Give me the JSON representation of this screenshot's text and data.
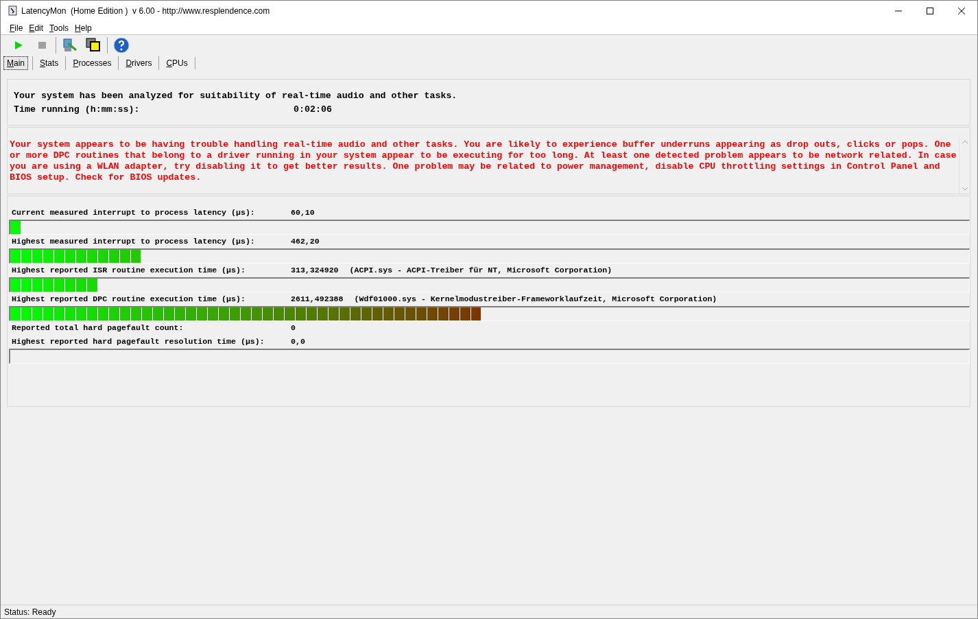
{
  "window": {
    "title": "LatencyMon  (Home Edition )  v 6.00 - http://www.resplendence.com"
  },
  "menu": [
    "File",
    "Edit",
    "Tools",
    "Help"
  ],
  "tabs": [
    {
      "label": "Main",
      "selected": true
    },
    {
      "label": "Stats",
      "selected": false
    },
    {
      "label": "Processes",
      "selected": false
    },
    {
      "label": "Drivers",
      "selected": false
    },
    {
      "label": "CPUs",
      "selected": false
    }
  ],
  "summary": {
    "message": "Your system has been analyzed for suitability of real-time audio and other tasks.",
    "time_label": "Time running (h:mm:ss):",
    "time_value": "0:02:06"
  },
  "verdict": "Your system appears to be having trouble handling real-time audio and other tasks. You are likely to experience buffer underruns appearing as drop outs, clicks or pops. One or more DPC routines that belong to a driver running in your system appear to be executing for too long. At least one detected problem appears to be network related. In case you are using a WLAN adapter, try disabling it to get better results. One problem may be related to power management, disable CPU throttling settings in Control Panel and BIOS setup. Check for BIOS updates.",
  "measurements": [
    {
      "kind": "meter",
      "label": "Current measured interrupt to process latency (µs):",
      "value": "60,10",
      "level": 0.011
    },
    {
      "kind": "meter",
      "label": "Highest measured interrupt to process latency (µs):",
      "value": "462,20",
      "level": 0.136
    },
    {
      "kind": "meter",
      "label": "Highest reported ISR routine execution time (µs):",
      "value": "313,324920",
      "detail": "(ACPI.sys - ACPI-Treiber für NT, Microsoft Corporation)",
      "level": 0.091
    },
    {
      "kind": "meter",
      "label": "Highest reported DPC routine execution time (µs):",
      "value": "2611,492388",
      "detail": "(Wdf01000.sys - Kernelmodustreiber-Frameworklaufzeit, Microsoft Corporation)",
      "level": 0.49
    },
    {
      "kind": "text",
      "label": "Reported total hard pagefault count:",
      "value": "0"
    },
    {
      "kind": "meter",
      "label": "Highest reported hard pagefault resolution time (µs):",
      "value": "0,0"
    }
  ],
  "status_bar": "Status: Ready"
}
